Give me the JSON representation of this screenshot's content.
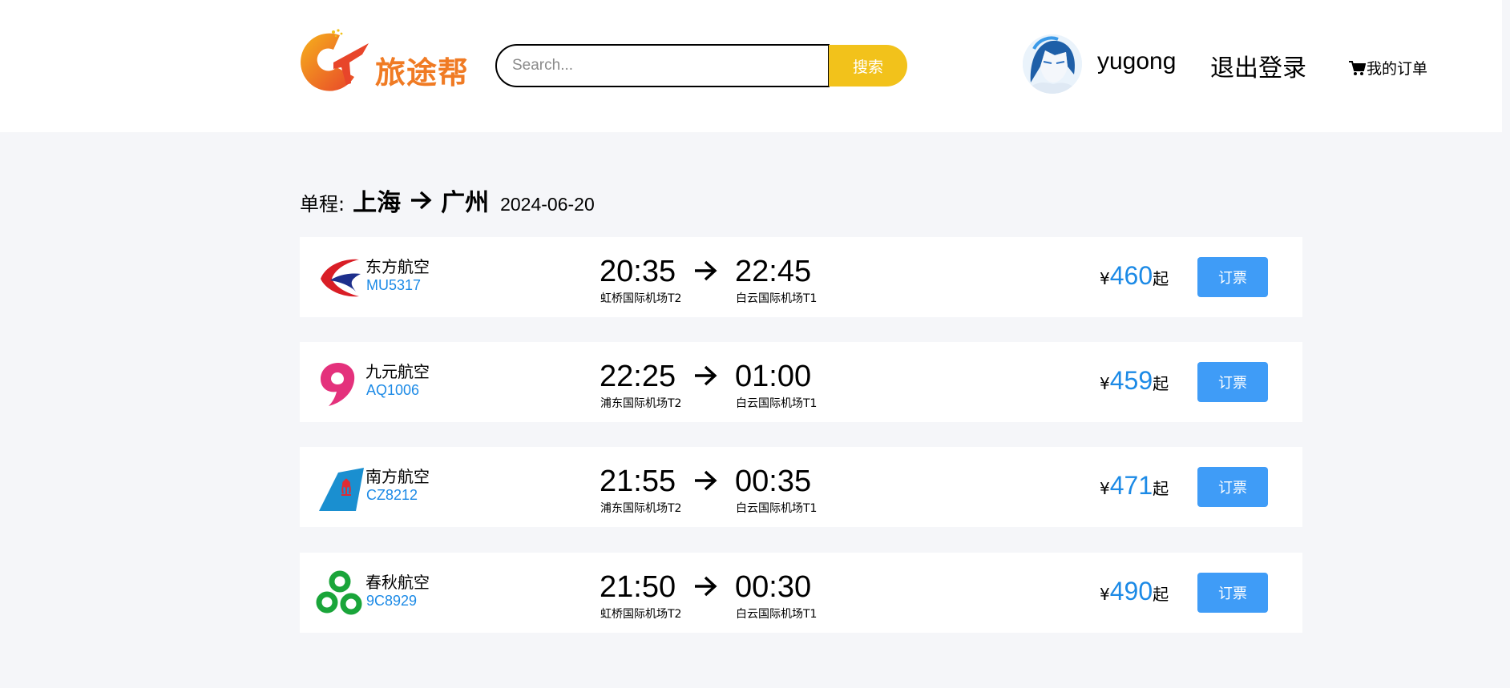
{
  "header": {
    "logo_text": "旅途帮",
    "search": {
      "placeholder": "Search...",
      "value": ""
    },
    "search_button": "搜索",
    "username": "yugong",
    "logout": "退出登录",
    "orders": "我的订单"
  },
  "route": {
    "trip_type": "单程",
    "colon": ":",
    "from_city": "上海",
    "to_city": "广州",
    "date": "2024-06-20"
  },
  "flights": [
    {
      "airline": "东方航空",
      "flight_no": "MU5317",
      "dep_time": "20:35",
      "dep_airport": "虹桥国际机场T2",
      "arr_time": "22:45",
      "arr_airport": "白云国际机场T1",
      "currency": "¥",
      "price": "460",
      "price_suffix": "起",
      "book_label": "订票",
      "logo": "china-eastern-logo"
    },
    {
      "airline": "九元航空",
      "flight_no": "AQ1006",
      "dep_time": "22:25",
      "dep_airport": "浦东国际机场T2",
      "arr_time": "01:00",
      "arr_airport": "白云国际机场T1",
      "currency": "¥",
      "price": "459",
      "price_suffix": "起",
      "book_label": "订票",
      "logo": "9air-logo"
    },
    {
      "airline": "南方航空",
      "flight_no": "CZ8212",
      "dep_time": "21:55",
      "dep_airport": "浦东国际机场T2",
      "arr_time": "00:35",
      "arr_airport": "白云国际机场T1",
      "currency": "¥",
      "price": "471",
      "price_suffix": "起",
      "book_label": "订票",
      "logo": "china-southern-logo"
    },
    {
      "airline": "春秋航空",
      "flight_no": "9C8929",
      "dep_time": "21:50",
      "dep_airport": "虹桥国际机场T2",
      "arr_time": "00:30",
      "arr_airport": "白云国际机场T1",
      "currency": "¥",
      "price": "490",
      "price_suffix": "起",
      "book_label": "订票",
      "logo": "spring-airlines-logo"
    }
  ],
  "colors": {
    "brand_orange": "#f07b24",
    "search_button": "#f2c21b",
    "link_blue": "#1c8ae6",
    "book_button": "#3f9cf7",
    "page_background": "#f5f6f9"
  }
}
